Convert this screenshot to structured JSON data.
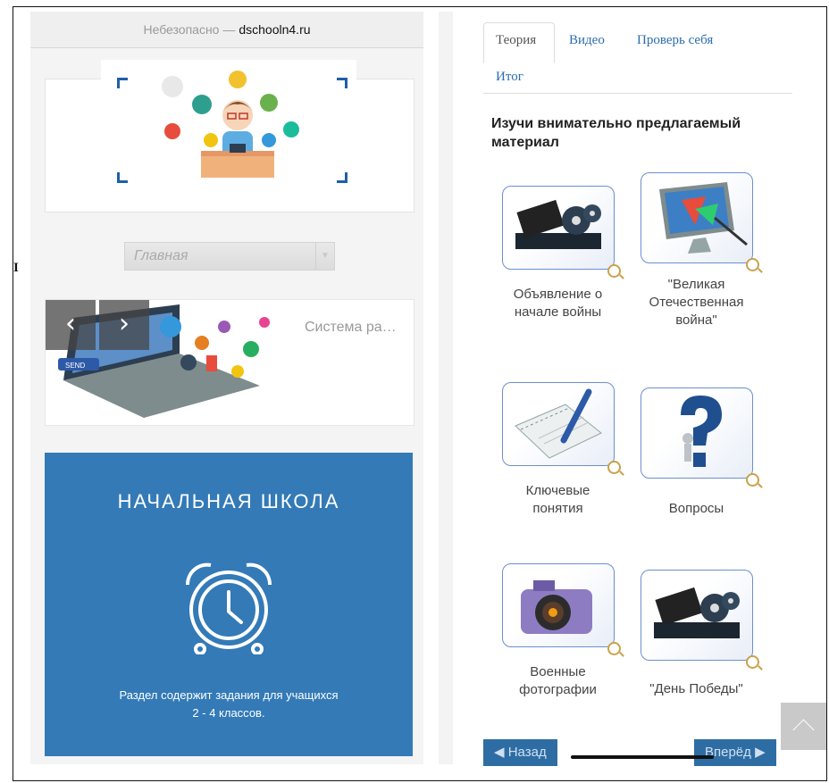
{
  "left": {
    "url_prefix": "Небезопасно —",
    "url_domain": "dschooln4.ru",
    "select_value": "Главная",
    "slide_caption": "Система ра…",
    "section_title": "НАЧАЛЬНАЯ ШКОЛА",
    "section_desc_1": "Раздел содержит задания для учащихся",
    "section_desc_2": "2 - 4 классов.",
    "badge": "SEND"
  },
  "stray_char": "I",
  "right": {
    "tabs": [
      {
        "label": "Теория",
        "active": true
      },
      {
        "label": "Видео",
        "active": false
      },
      {
        "label": "Проверь себя",
        "active": false
      },
      {
        "label": "Итог",
        "active": false
      }
    ],
    "heading": "Изучи внимательно предлагаемый материал",
    "tiles": [
      {
        "label_1": "Объявление о",
        "label_2": "начале войны",
        "label_3": "",
        "icon": "film-reel-icon"
      },
      {
        "label_1": "\"Великая",
        "label_2": "Отечественная",
        "label_3": "война\"",
        "icon": "monitor-icon"
      },
      {
        "label_1": "Ключевые",
        "label_2": "понятия",
        "label_3": "",
        "icon": "notebook-pen-icon"
      },
      {
        "label_1": "Вопросы",
        "label_2": "",
        "label_3": "",
        "icon": "question-mark-icon"
      },
      {
        "label_1": "Военные",
        "label_2": "фотографии",
        "label_3": "",
        "icon": "camera-icon"
      },
      {
        "label_1": "\"День Победы\"",
        "label_2": "",
        "label_3": "",
        "icon": "film-reel-icon"
      }
    ],
    "prev_button": "Назад",
    "next_button": "Вперёд"
  },
  "colors": {
    "blue_box": "#337ab7",
    "tab_link": "#2b6cb0",
    "thumb_border": "#6b8fcf"
  }
}
